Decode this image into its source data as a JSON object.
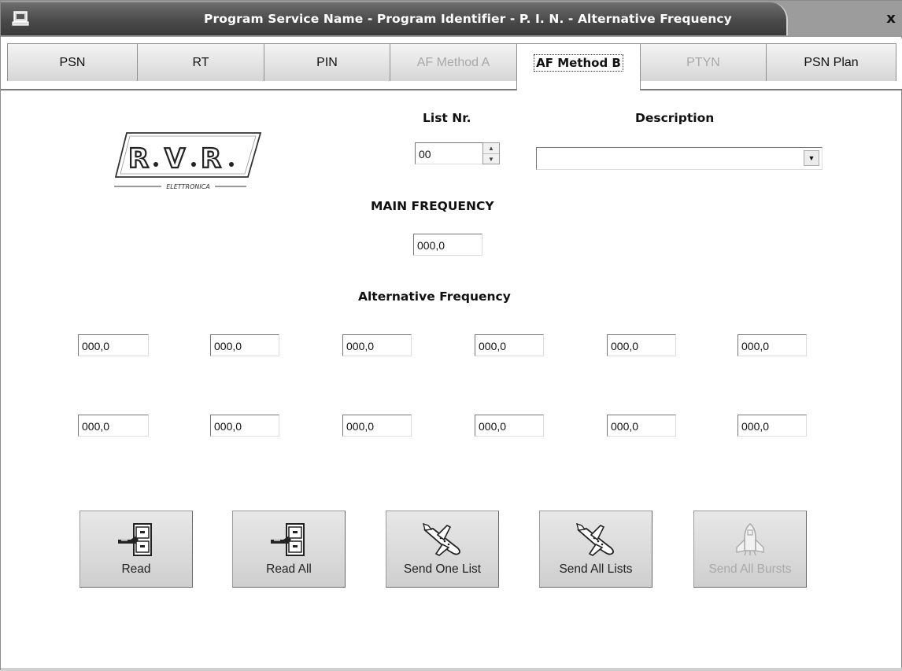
{
  "window": {
    "title": "Program Service Name - Program Identifier - P. I. N. - Alternative Frequency",
    "icons": {
      "app": "computer-icon",
      "close": "close-icon"
    },
    "close_label": "x"
  },
  "tabs": [
    {
      "label": "PSN",
      "state": "normal"
    },
    {
      "label": "RT",
      "state": "normal"
    },
    {
      "label": "PIN",
      "state": "normal"
    },
    {
      "label": "AF Method A",
      "state": "disabled"
    },
    {
      "label": "AF Method B",
      "state": "active"
    },
    {
      "label": "PTYN",
      "state": "disabled"
    },
    {
      "label": "PSN Plan",
      "state": "normal"
    }
  ],
  "logo": {
    "letters": [
      "R",
      "V",
      "R"
    ],
    "subtitle": "ELETTRONICA"
  },
  "list": {
    "label": "List Nr.",
    "value": "00"
  },
  "description": {
    "label": "Description",
    "value": ""
  },
  "main_frequency": {
    "label": "MAIN FREQUENCY",
    "value": "000,0"
  },
  "alternative_frequency": {
    "label": "Alternative Frequency",
    "rows": [
      [
        "000,0",
        "000,0",
        "000,0",
        "000,0",
        "000,0",
        "000,0"
      ],
      [
        "000,0",
        "000,0",
        "000,0",
        "000,0",
        "000,0",
        "000,0"
      ]
    ]
  },
  "buttons": [
    {
      "label": "Read",
      "icon": "file-cabinet-icon",
      "enabled": true
    },
    {
      "label": "Read All",
      "icon": "file-cabinet-icon",
      "enabled": true
    },
    {
      "label": "Send One List",
      "icon": "airplane-icon",
      "enabled": true
    },
    {
      "label": "Send All Lists",
      "icon": "airplane-icon",
      "enabled": true
    },
    {
      "label": "Send All Bursts",
      "icon": "space-shuttle-icon",
      "enabled": false
    }
  ],
  "colors": {
    "title_bar": "#4a4a4a",
    "disabled_text": "#a8a8a8"
  }
}
